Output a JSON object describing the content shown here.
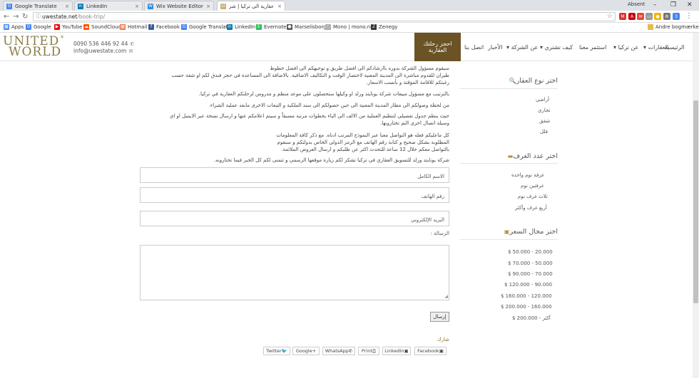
{
  "browser": {
    "tabs": [
      {
        "label": "Google Translate",
        "icon": "google-translate-icon"
      },
      {
        "label": "LinkedIn",
        "icon": "linkedin-icon"
      },
      {
        "label": "Wix Website Editor",
        "icon": "wix-icon"
      },
      {
        "label": "رحلة عقارية الى تركيا | شر",
        "icon": "site-favicon"
      }
    ],
    "profile_name": "Absent",
    "url_domain": "uwestate.net",
    "url_path": "/book-trip/",
    "bookmarks": [
      "Apps",
      "Google",
      "YouTube",
      "SoundCloud",
      "Hotmail",
      "Facebook",
      "Google Translate",
      "LinkedIn",
      "Evernote",
      "Marselisborg",
      "Mono | mono.net",
      "Zenegy"
    ],
    "other_bookmarks": "Andre bogmærker"
  },
  "header": {
    "logo_line1": "UNITED",
    "logo_line2": "WORLD",
    "phone": "0090 536 446 92 44",
    "email": "info@uwestate.com",
    "cta_label": "احجز رحلتك العقارية",
    "nav": [
      "الرئيسية",
      "العقارات",
      "عن تركيا",
      "استثمر معنا",
      "كيف تشتري",
      "عن الشركة",
      "الأخبار",
      "اتصل بنا"
    ]
  },
  "main": {
    "paragraphs": [
      "سيقوم مسؤول الشركة بدوره باارشادكم الى افضل طريق و توجيهكم الى افضل خطوط",
      "طيران للقدوم مباشرة الى المدينة المعنية لاختصار الوقت و التكاليف الاضافية. بالاضافة الى المساعدة في حجز فندق لكم او شقة حسب",
      "رغبتكم للاقامة المؤقتة و بأنسب الاسعار.",
      "بالترتيب مع مسؤول مبيعات شركة يونايتد ورلد او وكيلها ستحصلون على موعد منظم و مدروس لرحلتكم العقارية في تركيا.",
      "من لحظة وصولكم الى مطار المدينة المعنية الى حين حصولكم الى سند الملكية و التبعات الاخرى مابعد عملية الشراء.",
      "حيث ينظم جدول تفصيلي لتنظيم العملية من الالف الى الياء بخطوات مرتبة مسبقاً و سيتم اعلامكم عنها و ارسال نسخة عبر الايميل او اي",
      "وسيلة اتصال اخرى التم تختارونها.",
      "كل ماعليكم فعله هو التواصل معنا عبر النموذج المرتب ادناه. مع ذكر كافة المعلومات",
      "المطلوبة بشكل صحيح و كتابة رقم الهاتف مع الرمز الدولي الخاص بدولتكم و سنقوم",
      "بالتواصل معكم خلال 12 ساعة للتحدث اكثر عن طلبكم و ارسال العروض الملائمة.",
      "شركة يونايتد ورلد للتسويق العقاري في تركيا تشكر لكم زيارة موقعها الرسمي و تتمنى لكم كل الخير فيما تختارونه."
    ],
    "form": {
      "name_placeholder": "الاسم الكامل",
      "phone_placeholder": "رقم الهاتف",
      "email_placeholder": "البريد الإلكتروني",
      "message_label": "الرسالة :",
      "submit_label": "إرسال"
    },
    "share": {
      "label": "شارك",
      "buttons": [
        "Twitter",
        "Google+",
        "WhatsApp",
        "Print",
        "LinkedIn",
        "Facebook"
      ]
    }
  },
  "sidebar": {
    "property_type": {
      "heading": "اختر نوع العقار",
      "items": [
        "أراضي",
        "تجاري",
        "شقق",
        "فلل"
      ]
    },
    "rooms": {
      "heading": "اختر عدد الغرف",
      "items": [
        "غرفة نوم واحدة",
        "غرفتين نوم",
        "ثلاث غرف نوم",
        "أربع غرف وأكثر"
      ]
    },
    "price": {
      "heading": "اختر مجال السعر",
      "items": [
        "$ 50.000 - 20.000",
        "$ 70.000 - 50.000",
        "$ 90.000 - 70.000",
        "$ 120.000 - 90.000",
        "$ 160.000 - 120.000",
        "$ 200.000 - 160.000",
        "$ 200.000 - أكثر"
      ]
    }
  },
  "colors": {
    "accent": "#6b5326",
    "logo": "#8a7d4a",
    "icon_gold": "#b08b3a"
  }
}
